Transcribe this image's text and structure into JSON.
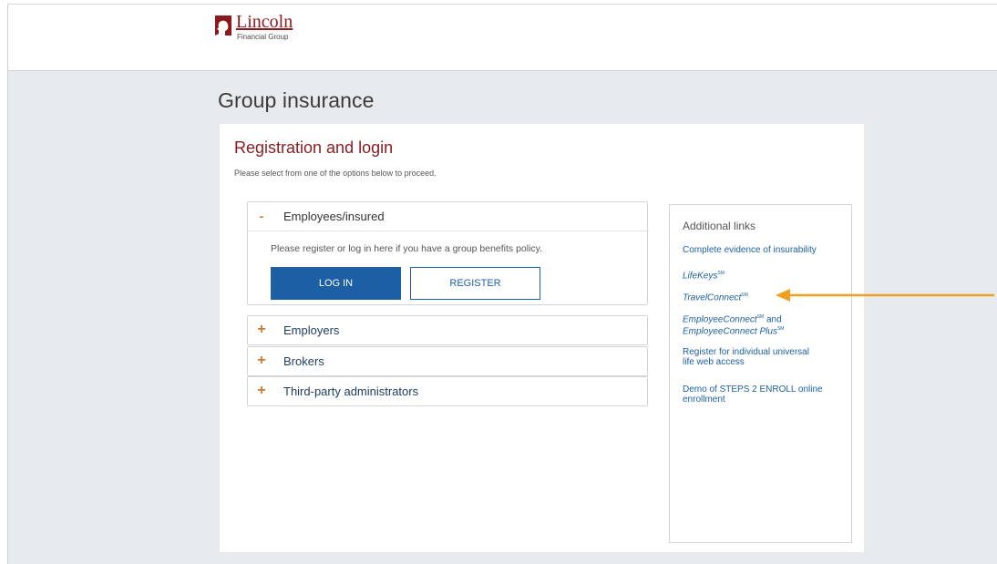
{
  "brand": {
    "name": "Lincoln",
    "sub": "Financial Group",
    "colors": {
      "brand_red": "#8b1a1e",
      "accent_blue": "#1d5fa4",
      "accent_orange": "#d4782a",
      "arrow": "#f0a020"
    }
  },
  "page": {
    "title": "Group insurance"
  },
  "panel": {
    "heading": "Registration and login",
    "subtext": "Please select from one of the options below to proceed."
  },
  "accordion": [
    {
      "sign": "-",
      "label": "Employees/insured",
      "expanded": true,
      "body_text": "Please register or log in here if you have a group benefits policy.",
      "login_label": "LOG IN",
      "register_label": "REGISTER"
    },
    {
      "sign": "+",
      "label": "Employers",
      "expanded": false
    },
    {
      "sign": "+",
      "label": "Brokers",
      "expanded": false
    },
    {
      "sign": "+",
      "label": "Third-party administrators",
      "expanded": false
    }
  ],
  "links": {
    "title": "Additional links",
    "items": [
      {
        "text": "Complete evidence of insurability"
      },
      {
        "text": "LifeKeys",
        "mark": "SM"
      },
      {
        "text": "TravelConnect",
        "mark": "SM"
      },
      {
        "text_a": "EmployeeConnect",
        "mark_a": "SM",
        "text_b": " and",
        "text_c": "EmployeeConnect Plus",
        "mark_c": "SM"
      },
      {
        "line1": "Register for individual universal",
        "line2": "life web access"
      },
      {
        "line1": "Demo of STEPS 2 ENROLL online",
        "line2": "enrollment"
      }
    ]
  },
  "annotation": {
    "icon": "arrow-left-icon",
    "points_to": "TravelConnect"
  }
}
